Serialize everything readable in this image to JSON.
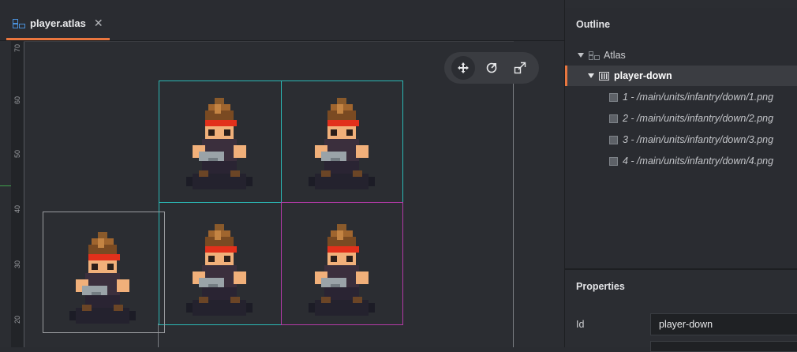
{
  "tab": {
    "title": "player.atlas",
    "close_glyph": "✕",
    "icon": "atlas-icon"
  },
  "ruler": {
    "labels": [
      "70",
      "60",
      "50",
      "40",
      "30",
      "20"
    ]
  },
  "toolbar": {
    "tools": [
      "move-icon",
      "rotate-icon",
      "scale-icon"
    ]
  },
  "outline": {
    "title": "Outline",
    "root": "Atlas",
    "animation": "player-down",
    "images": [
      "1 - /main/units/infantry/down/1.png",
      "2 - /main/units/infantry/down/2.png",
      "3 - /main/units/infantry/down/3.png",
      "4 - /main/units/infantry/down/4.png"
    ]
  },
  "properties": {
    "title": "Properties",
    "id_label": "Id",
    "id_value": "player-down"
  },
  "colors": {
    "accent": "#e9763f",
    "frame_cyan": "#2bb8b5",
    "frame_magenta": "#b43aa8",
    "frame_gray": "#9a9ca0"
  }
}
